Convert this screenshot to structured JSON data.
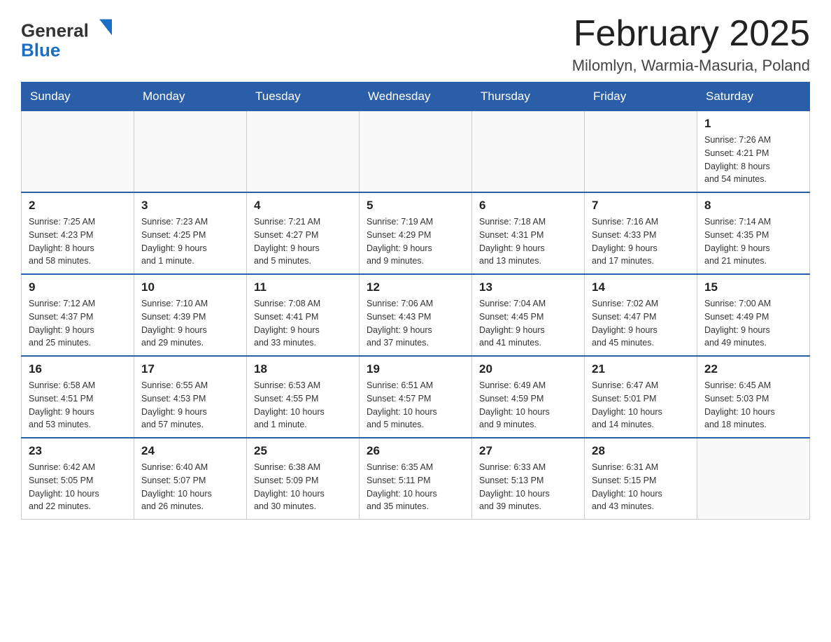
{
  "header": {
    "logo": {
      "general": "General",
      "blue": "Blue",
      "arrow_color": "#1a6fc4"
    },
    "title": "February 2025",
    "location": "Milomlyn, Warmia-Masuria, Poland"
  },
  "weekdays": [
    "Sunday",
    "Monday",
    "Tuesday",
    "Wednesday",
    "Thursday",
    "Friday",
    "Saturday"
  ],
  "weeks": [
    {
      "days": [
        {
          "number": "",
          "info": ""
        },
        {
          "number": "",
          "info": ""
        },
        {
          "number": "",
          "info": ""
        },
        {
          "number": "",
          "info": ""
        },
        {
          "number": "",
          "info": ""
        },
        {
          "number": "",
          "info": ""
        },
        {
          "number": "1",
          "info": "Sunrise: 7:26 AM\nSunset: 4:21 PM\nDaylight: 8 hours\nand 54 minutes."
        }
      ]
    },
    {
      "days": [
        {
          "number": "2",
          "info": "Sunrise: 7:25 AM\nSunset: 4:23 PM\nDaylight: 8 hours\nand 58 minutes."
        },
        {
          "number": "3",
          "info": "Sunrise: 7:23 AM\nSunset: 4:25 PM\nDaylight: 9 hours\nand 1 minute."
        },
        {
          "number": "4",
          "info": "Sunrise: 7:21 AM\nSunset: 4:27 PM\nDaylight: 9 hours\nand 5 minutes."
        },
        {
          "number": "5",
          "info": "Sunrise: 7:19 AM\nSunset: 4:29 PM\nDaylight: 9 hours\nand 9 minutes."
        },
        {
          "number": "6",
          "info": "Sunrise: 7:18 AM\nSunset: 4:31 PM\nDaylight: 9 hours\nand 13 minutes."
        },
        {
          "number": "7",
          "info": "Sunrise: 7:16 AM\nSunset: 4:33 PM\nDaylight: 9 hours\nand 17 minutes."
        },
        {
          "number": "8",
          "info": "Sunrise: 7:14 AM\nSunset: 4:35 PM\nDaylight: 9 hours\nand 21 minutes."
        }
      ]
    },
    {
      "days": [
        {
          "number": "9",
          "info": "Sunrise: 7:12 AM\nSunset: 4:37 PM\nDaylight: 9 hours\nand 25 minutes."
        },
        {
          "number": "10",
          "info": "Sunrise: 7:10 AM\nSunset: 4:39 PM\nDaylight: 9 hours\nand 29 minutes."
        },
        {
          "number": "11",
          "info": "Sunrise: 7:08 AM\nSunset: 4:41 PM\nDaylight: 9 hours\nand 33 minutes."
        },
        {
          "number": "12",
          "info": "Sunrise: 7:06 AM\nSunset: 4:43 PM\nDaylight: 9 hours\nand 37 minutes."
        },
        {
          "number": "13",
          "info": "Sunrise: 7:04 AM\nSunset: 4:45 PM\nDaylight: 9 hours\nand 41 minutes."
        },
        {
          "number": "14",
          "info": "Sunrise: 7:02 AM\nSunset: 4:47 PM\nDaylight: 9 hours\nand 45 minutes."
        },
        {
          "number": "15",
          "info": "Sunrise: 7:00 AM\nSunset: 4:49 PM\nDaylight: 9 hours\nand 49 minutes."
        }
      ]
    },
    {
      "days": [
        {
          "number": "16",
          "info": "Sunrise: 6:58 AM\nSunset: 4:51 PM\nDaylight: 9 hours\nand 53 minutes."
        },
        {
          "number": "17",
          "info": "Sunrise: 6:55 AM\nSunset: 4:53 PM\nDaylight: 9 hours\nand 57 minutes."
        },
        {
          "number": "18",
          "info": "Sunrise: 6:53 AM\nSunset: 4:55 PM\nDaylight: 10 hours\nand 1 minute."
        },
        {
          "number": "19",
          "info": "Sunrise: 6:51 AM\nSunset: 4:57 PM\nDaylight: 10 hours\nand 5 minutes."
        },
        {
          "number": "20",
          "info": "Sunrise: 6:49 AM\nSunset: 4:59 PM\nDaylight: 10 hours\nand 9 minutes."
        },
        {
          "number": "21",
          "info": "Sunrise: 6:47 AM\nSunset: 5:01 PM\nDaylight: 10 hours\nand 14 minutes."
        },
        {
          "number": "22",
          "info": "Sunrise: 6:45 AM\nSunset: 5:03 PM\nDaylight: 10 hours\nand 18 minutes."
        }
      ]
    },
    {
      "days": [
        {
          "number": "23",
          "info": "Sunrise: 6:42 AM\nSunset: 5:05 PM\nDaylight: 10 hours\nand 22 minutes."
        },
        {
          "number": "24",
          "info": "Sunrise: 6:40 AM\nSunset: 5:07 PM\nDaylight: 10 hours\nand 26 minutes."
        },
        {
          "number": "25",
          "info": "Sunrise: 6:38 AM\nSunset: 5:09 PM\nDaylight: 10 hours\nand 30 minutes."
        },
        {
          "number": "26",
          "info": "Sunrise: 6:35 AM\nSunset: 5:11 PM\nDaylight: 10 hours\nand 35 minutes."
        },
        {
          "number": "27",
          "info": "Sunrise: 6:33 AM\nSunset: 5:13 PM\nDaylight: 10 hours\nand 39 minutes."
        },
        {
          "number": "28",
          "info": "Sunrise: 6:31 AM\nSunset: 5:15 PM\nDaylight: 10 hours\nand 43 minutes."
        },
        {
          "number": "",
          "info": ""
        }
      ]
    }
  ]
}
